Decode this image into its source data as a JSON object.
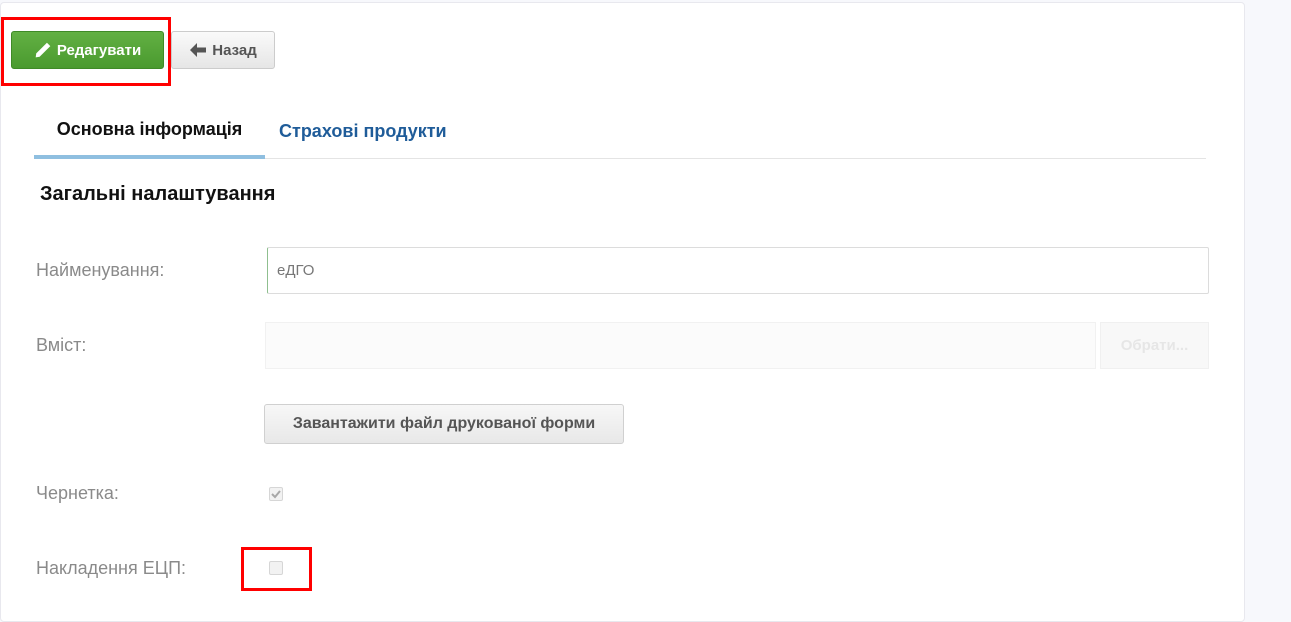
{
  "toolbar": {
    "edit_label": "Редагувати",
    "back_label": "Назад"
  },
  "tabs": [
    {
      "label": "Основна інформація",
      "active": true
    },
    {
      "label": "Страхові продукти",
      "active": false
    }
  ],
  "section": {
    "title": "Загальні налаштування"
  },
  "form": {
    "name_label": "Найменування:",
    "name_value": "еДГО",
    "content_label": "Вміст:",
    "content_value": "",
    "choose_label": "Обрати...",
    "upload_label": "Завантажити файл друкованої форми",
    "draft_label": "Чернетка:",
    "draft_checked": true,
    "signature_label": "Накладення ЕЦП:",
    "signature_checked": false
  },
  "icons": {
    "edit": "pencil-icon",
    "back": "arrow-left-icon",
    "check": "checkmark-icon"
  },
  "colors": {
    "edit_button": "#52a336",
    "active_tab_underline": "#8fbfe0",
    "link_tab": "#1f5c99",
    "highlight": "#ff0000"
  }
}
